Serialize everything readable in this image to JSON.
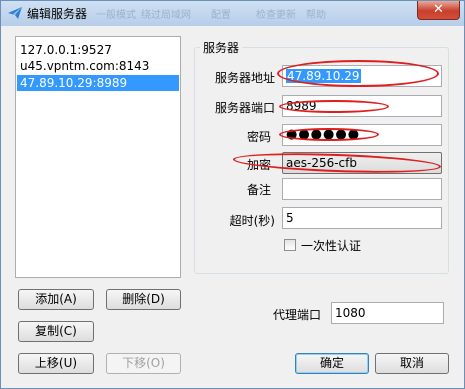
{
  "window": {
    "title": "编辑服务器",
    "close_glyph": "✕",
    "ghost_title_fragments": [
      "一般模式",
      "绕过局域网",
      "配置",
      "检查更新",
      "帮助"
    ]
  },
  "servers": [
    {
      "address": "127.0.0.1:9527"
    },
    {
      "address": "u45.vpntm.com:8143"
    },
    {
      "address": "47.89.10.29:8989",
      "selected": true
    }
  ],
  "buttons": {
    "add": "添加(A)",
    "delete": "删除(D)",
    "copy": "复制(C)",
    "move_up": "上移(U)",
    "move_down": "下移(O)",
    "ok": "确定",
    "cancel": "取消"
  },
  "server_group": {
    "title": "服务器",
    "address_label": "服务器地址",
    "address_value": "47.89.10.29",
    "port_label": "服务器端口",
    "port_value": "8989",
    "password_label": "密码",
    "password_mask": "●●●●●●",
    "encryption_label": "加密",
    "encryption_value": "aes-256-cfb",
    "remarks_label": "备注",
    "remarks_value": "",
    "timeout_label": "超时(秒)",
    "timeout_value": "5",
    "onetime_auth_label": "一次性认证",
    "onetime_auth_checked": false
  },
  "proxy": {
    "port_label": "代理端口",
    "port_value": "1080"
  },
  "colors": {
    "selection": "#3399ff",
    "annotation": "#e01e1e"
  }
}
